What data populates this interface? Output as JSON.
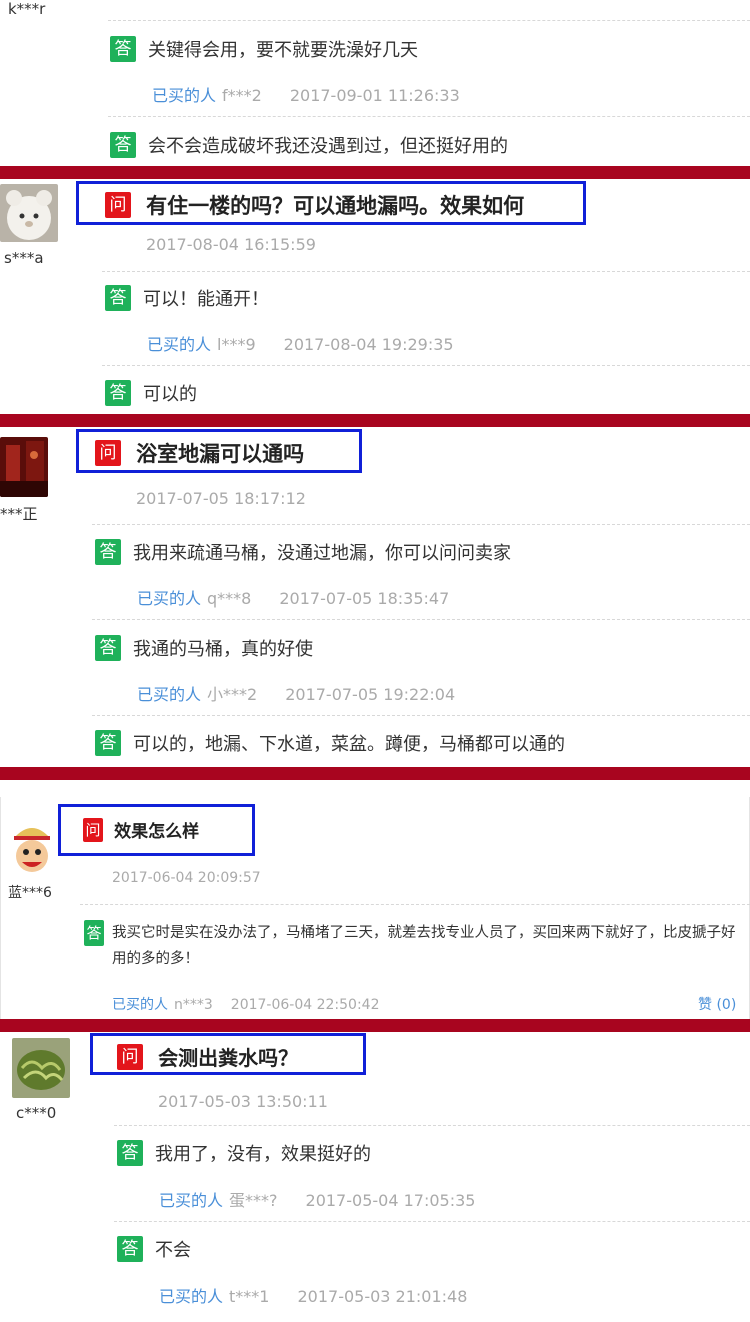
{
  "colors": {
    "separator": "#a8051f",
    "question_tag": "#e3151b",
    "answer_tag": "#1fb15a",
    "highlight_box": "#1020d8",
    "buyer_link": "#4a8fd8"
  },
  "labels": {
    "question_tag": "问",
    "answer_tag": "答",
    "buyer_prefix": "已买的人",
    "praise": "赞 (0)"
  },
  "top": {
    "username": "k***r",
    "answers": [
      {
        "text": "关键得会用，要不就要洗澡好几天",
        "buyer": "f***2",
        "time": "2017-09-01 11:26:33"
      },
      {
        "text": "会不会造成破坏我还没遇到过，但还挺好用的"
      }
    ]
  },
  "questions": [
    {
      "username": "s***a",
      "avatar": "white-plush-toy",
      "question": "有住一楼的吗？可以通地漏吗。效果如何",
      "time": "2017-08-04 16:15:59",
      "answers": [
        {
          "text": "可以！能通开！",
          "buyer": "l***9",
          "time": "2017-08-04 19:29:35"
        },
        {
          "text": "可以的"
        }
      ]
    },
    {
      "username": "***正",
      "avatar": "dark-red-room",
      "question": "浴室地漏可以通吗",
      "time": "2017-07-05 18:17:12",
      "answers": [
        {
          "text": "我用来疏通马桶，没通过地漏，你可以问问卖家",
          "buyer": "q***8",
          "time": "2017-07-05 18:35:47"
        },
        {
          "text": "我通的马桶，真的好使",
          "buyer": "小***2",
          "time": "2017-07-05 19:22:04"
        },
        {
          "text": "可以的，地漏、下水道，菜盆。蹲便，马桶都可以通的"
        }
      ]
    },
    {
      "username": "蓝***6",
      "avatar": "cartoon-face",
      "question": "效果怎么样",
      "time": "2017-06-04 20:09:57",
      "answers": [
        {
          "text_line1": "我买它时是实在没办法了，马桶堵了三天，就差去找专业人员了，买回来两下就好了，比皮搋子好",
          "text_line2": "用的多的多！",
          "buyer": "n***3",
          "time": "2017-06-04 22:50:42"
        }
      ]
    },
    {
      "username": "c***0",
      "avatar": "green-food",
      "question": "会测出粪水吗？",
      "time": "2017-05-03 13:50:11",
      "answers": [
        {
          "text": "我用了，没有，效果挺好的",
          "buyer": "蛋***?",
          "time": "2017-05-04 17:05:35"
        },
        {
          "text": "不会",
          "buyer": "t***1",
          "time": "2017-05-03 21:01:48"
        }
      ]
    }
  ]
}
